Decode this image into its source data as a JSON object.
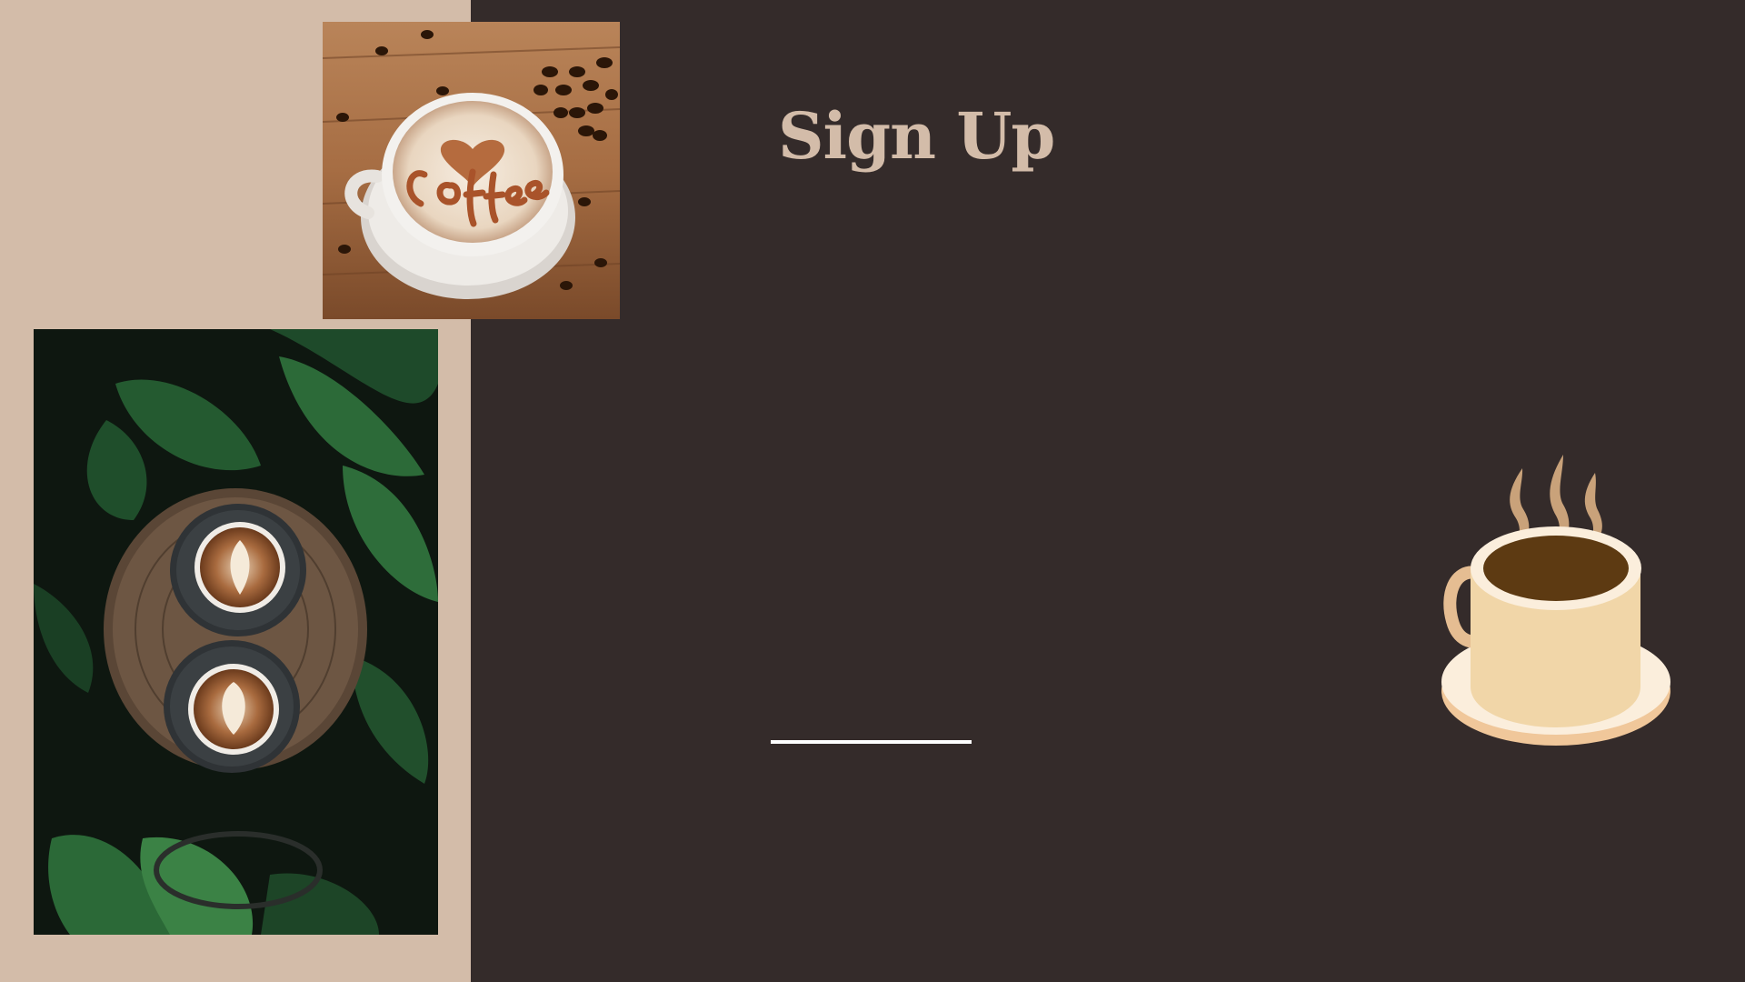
{
  "page": {
    "title": "Sign Up"
  },
  "colors": {
    "left_panel": "#d3bca9",
    "main_background": "#342b2a",
    "title": "#d3bca9",
    "underline": "#ffffff",
    "cup_body": "#f1d6a8",
    "cup_coffee": "#5d3a12",
    "steam": "#c9a27a"
  },
  "images": {
    "top_photo": "coffee-heart-cup-photo",
    "side_photo": "latte-art-cups-with-plants-photo",
    "illustration": "steaming-coffee-cup-illustration"
  }
}
